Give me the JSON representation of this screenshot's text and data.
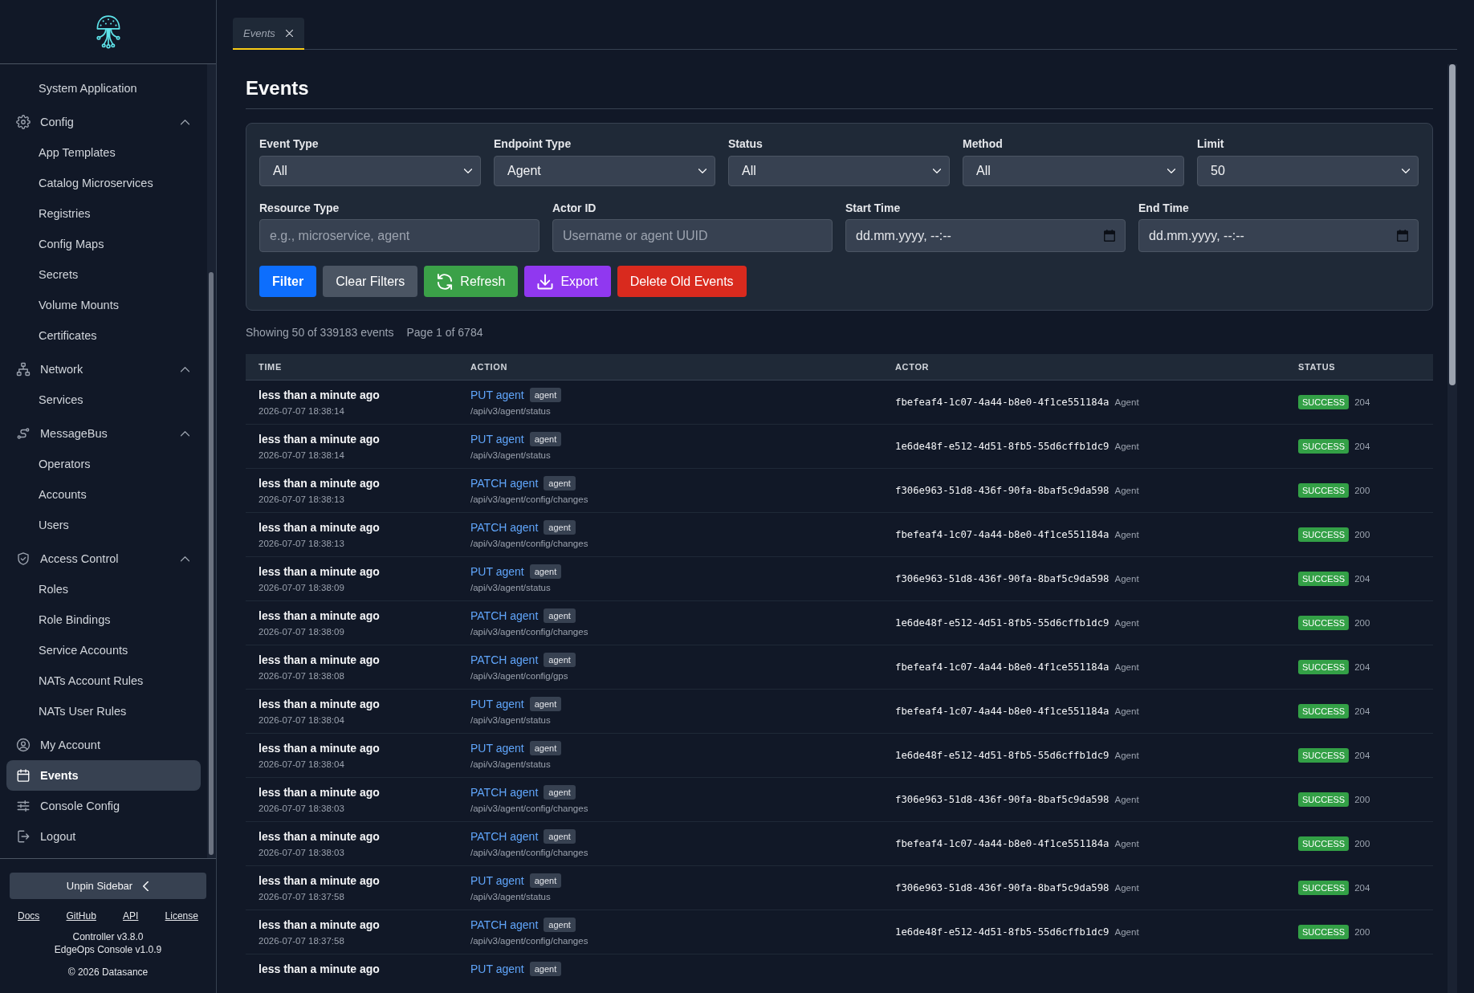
{
  "sidebar": {
    "nav": [
      {
        "kind": "child",
        "label": "System Application",
        "selected": false
      },
      {
        "kind": "group",
        "label": "Config",
        "expanded": true,
        "children": [
          {
            "label": "App Templates",
            "selected": false
          },
          {
            "label": "Catalog Microservices",
            "selected": false
          },
          {
            "label": "Registries",
            "selected": false
          },
          {
            "label": "Config Maps",
            "selected": false
          },
          {
            "label": "Secrets",
            "selected": false
          },
          {
            "label": "Volume Mounts",
            "selected": false
          },
          {
            "label": "Certificates",
            "selected": false
          }
        ]
      },
      {
        "kind": "group",
        "label": "Network",
        "expanded": true,
        "children": [
          {
            "label": "Services",
            "selected": false
          }
        ]
      },
      {
        "kind": "group",
        "label": "MessageBus",
        "expanded": true,
        "children": [
          {
            "label": "Operators",
            "selected": false
          },
          {
            "label": "Accounts",
            "selected": false
          },
          {
            "label": "Users",
            "selected": false
          }
        ]
      },
      {
        "kind": "group",
        "label": "Access Control",
        "expanded": true,
        "children": [
          {
            "label": "Roles",
            "selected": false
          },
          {
            "label": "Role Bindings",
            "selected": false
          },
          {
            "label": "Service Accounts",
            "selected": false
          },
          {
            "label": "NATs Account Rules",
            "selected": false
          },
          {
            "label": "NATs User Rules",
            "selected": false
          }
        ]
      },
      {
        "kind": "link",
        "label": "My Account",
        "selected": false
      },
      {
        "kind": "link",
        "label": "Events",
        "selected": true
      },
      {
        "kind": "link",
        "label": "Console Config",
        "selected": false
      },
      {
        "kind": "link",
        "label": "Logout",
        "selected": false
      }
    ],
    "unpin_button": {
      "label": "Unpin Sidebar"
    },
    "links": [
      "Docs",
      "GitHub",
      "API",
      "License"
    ],
    "versions": [
      "Controller v3.8.0",
      "EdgeOps Console v1.0.9"
    ],
    "copyright": "© 2026 Datasance"
  },
  "tabs": [
    {
      "label": "Events",
      "selected": true
    }
  ],
  "page": {
    "title": "Events"
  },
  "filters": {
    "selects": [
      {
        "label": "Event Type",
        "value": "All"
      },
      {
        "label": "Endpoint Type",
        "value": "Agent"
      },
      {
        "label": "Status",
        "value": "All"
      },
      {
        "label": "Method",
        "value": "All"
      },
      {
        "label": "Limit",
        "value": "50"
      }
    ],
    "inputs": [
      {
        "label": "Resource Type",
        "kind": "text",
        "placeholder": "e.g., microservice, agent"
      },
      {
        "label": "Actor ID",
        "kind": "text",
        "placeholder": "Username or agent UUID"
      },
      {
        "label": "Start Time",
        "kind": "datetime",
        "placeholder": "dd.mm.yyyy, --:--"
      },
      {
        "label": "End Time",
        "kind": "datetime",
        "placeholder": "dd.mm.yyyy, --:--"
      }
    ],
    "buttons": [
      {
        "label": "Filter",
        "kind": "primary"
      },
      {
        "label": "Clear Filters",
        "kind": "secondary"
      },
      {
        "label": "Refresh",
        "kind": "refresh"
      },
      {
        "label": "Export",
        "kind": "export"
      },
      {
        "label": "Delete Old Events",
        "kind": "danger"
      }
    ]
  },
  "summary": {
    "showing": "Showing 50 of 339183 events",
    "page": "Page 1 of 6784"
  },
  "table": {
    "columns": [
      "TIME",
      "ACTION",
      "ACTOR",
      "STATUS"
    ],
    "rows": [
      {
        "time": "less than a minute ago",
        "timestamp": "2026-07-07 18:38:14",
        "action": "PUT agent",
        "tag": "agent",
        "path": "/api/v3/agent/status",
        "actor": "fbefeaf4-1c07-4a44-b8e0-4f1ce551184a",
        "actor_type": "Agent",
        "status": "SUCCESS",
        "code": "204"
      },
      {
        "time": "less than a minute ago",
        "timestamp": "2026-07-07 18:38:14",
        "action": "PUT agent",
        "tag": "agent",
        "path": "/api/v3/agent/status",
        "actor": "1e6de48f-e512-4d51-8fb5-55d6cffb1dc9",
        "actor_type": "Agent",
        "status": "SUCCESS",
        "code": "204"
      },
      {
        "time": "less than a minute ago",
        "timestamp": "2026-07-07 18:38:13",
        "action": "PATCH agent",
        "tag": "agent",
        "path": "/api/v3/agent/config/changes",
        "actor": "f306e963-51d8-436f-90fa-8baf5c9da598",
        "actor_type": "Agent",
        "status": "SUCCESS",
        "code": "200"
      },
      {
        "time": "less than a minute ago",
        "timestamp": "2026-07-07 18:38:13",
        "action": "PATCH agent",
        "tag": "agent",
        "path": "/api/v3/agent/config/changes",
        "actor": "fbefeaf4-1c07-4a44-b8e0-4f1ce551184a",
        "actor_type": "Agent",
        "status": "SUCCESS",
        "code": "200"
      },
      {
        "time": "less than a minute ago",
        "timestamp": "2026-07-07 18:38:09",
        "action": "PUT agent",
        "tag": "agent",
        "path": "/api/v3/agent/status",
        "actor": "f306e963-51d8-436f-90fa-8baf5c9da598",
        "actor_type": "Agent",
        "status": "SUCCESS",
        "code": "204"
      },
      {
        "time": "less than a minute ago",
        "timestamp": "2026-07-07 18:38:09",
        "action": "PATCH agent",
        "tag": "agent",
        "path": "/api/v3/agent/config/changes",
        "actor": "1e6de48f-e512-4d51-8fb5-55d6cffb1dc9",
        "actor_type": "Agent",
        "status": "SUCCESS",
        "code": "200"
      },
      {
        "time": "less than a minute ago",
        "timestamp": "2026-07-07 18:38:08",
        "action": "PATCH agent",
        "tag": "agent",
        "path": "/api/v3/agent/config/gps",
        "actor": "fbefeaf4-1c07-4a44-b8e0-4f1ce551184a",
        "actor_type": "Agent",
        "status": "SUCCESS",
        "code": "204"
      },
      {
        "time": "less than a minute ago",
        "timestamp": "2026-07-07 18:38:04",
        "action": "PUT agent",
        "tag": "agent",
        "path": "/api/v3/agent/status",
        "actor": "fbefeaf4-1c07-4a44-b8e0-4f1ce551184a",
        "actor_type": "Agent",
        "status": "SUCCESS",
        "code": "204"
      },
      {
        "time": "less than a minute ago",
        "timestamp": "2026-07-07 18:38:04",
        "action": "PUT agent",
        "tag": "agent",
        "path": "/api/v3/agent/status",
        "actor": "1e6de48f-e512-4d51-8fb5-55d6cffb1dc9",
        "actor_type": "Agent",
        "status": "SUCCESS",
        "code": "204"
      },
      {
        "time": "less than a minute ago",
        "timestamp": "2026-07-07 18:38:03",
        "action": "PATCH agent",
        "tag": "agent",
        "path": "/api/v3/agent/config/changes",
        "actor": "f306e963-51d8-436f-90fa-8baf5c9da598",
        "actor_type": "Agent",
        "status": "SUCCESS",
        "code": "200"
      },
      {
        "time": "less than a minute ago",
        "timestamp": "2026-07-07 18:38:03",
        "action": "PATCH agent",
        "tag": "agent",
        "path": "/api/v3/agent/config/changes",
        "actor": "fbefeaf4-1c07-4a44-b8e0-4f1ce551184a",
        "actor_type": "Agent",
        "status": "SUCCESS",
        "code": "200"
      },
      {
        "time": "less than a minute ago",
        "timestamp": "2026-07-07 18:37:58",
        "action": "PUT agent",
        "tag": "agent",
        "path": "/api/v3/agent/status",
        "actor": "f306e963-51d8-436f-90fa-8baf5c9da598",
        "actor_type": "Agent",
        "status": "SUCCESS",
        "code": "204"
      },
      {
        "time": "less than a minute ago",
        "timestamp": "2026-07-07 18:37:58",
        "action": "PATCH agent",
        "tag": "agent",
        "path": "/api/v3/agent/config/changes",
        "actor": "1e6de48f-e512-4d51-8fb5-55d6cffb1dc9",
        "actor_type": "Agent",
        "status": "SUCCESS",
        "code": "200"
      },
      {
        "time": "less than a minute ago",
        "action": "PUT agent",
        "tag": "agent"
      }
    ]
  }
}
